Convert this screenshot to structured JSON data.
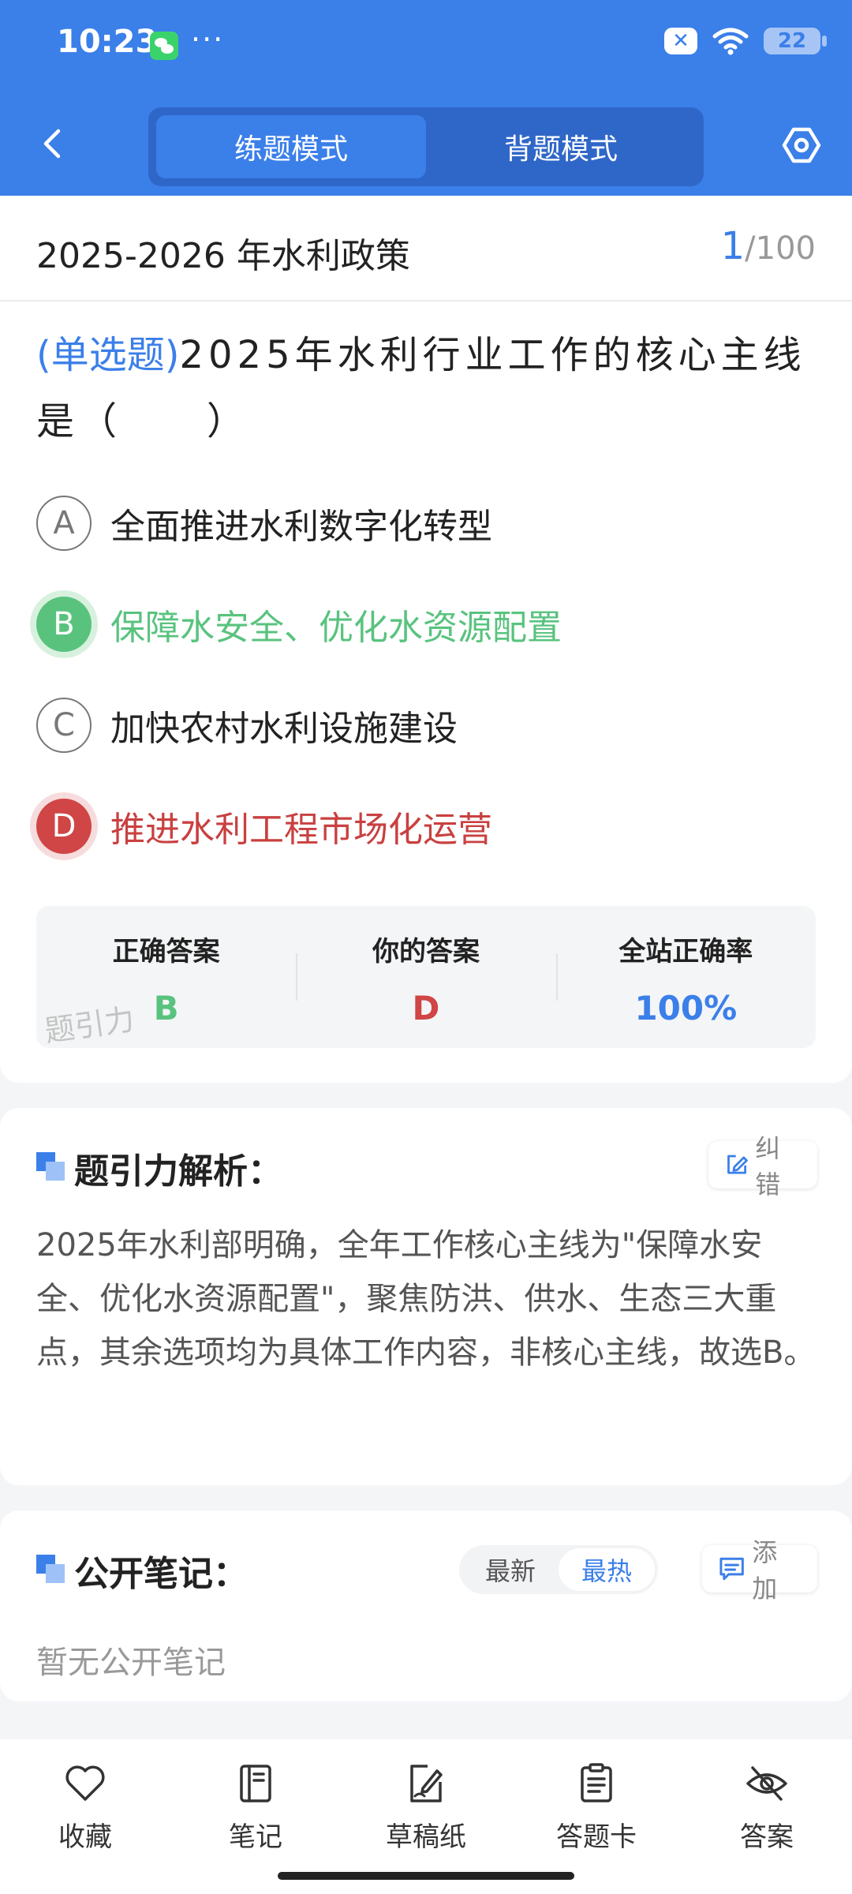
{
  "status_bar": {
    "time": "10:23",
    "more": "···",
    "notif_badge": "✕",
    "battery": "22"
  },
  "header": {
    "modes": [
      "练题模式",
      "背题模式"
    ],
    "active_mode": 0
  },
  "question_card": {
    "subject": "2025-2026 年水利政策",
    "progress_current": "1",
    "progress_total": "/100",
    "question_type": "(单选题)",
    "question_text": "2025年水利行业工作的核心主线是（　　）",
    "options": [
      {
        "letter": "A",
        "text": "全面推进水利数字化转型",
        "state": "normal"
      },
      {
        "letter": "B",
        "text": "保障水安全、优化水资源配置",
        "state": "correct"
      },
      {
        "letter": "C",
        "text": "加快农村水利设施建设",
        "state": "normal"
      },
      {
        "letter": "D",
        "text": "推进水利工程市场化运营",
        "state": "wrong"
      }
    ],
    "summary": {
      "correct_label": "正确答案",
      "correct_value": "B",
      "yours_label": "你的答案",
      "yours_value": "D",
      "rate_label": "全站正确率",
      "rate_value": "100%"
    },
    "watermark": "题引力"
  },
  "analysis": {
    "title": "题引力解析：",
    "correct_btn": "纠错",
    "text": "2025年水利部明确，全年工作核心主线为\"保障水安全、优化水资源配置\"，聚焦防洪、供水、生态三大重点，其余选项均为具体工作内容，非核心主线，故选B。"
  },
  "notes": {
    "title": "公开笔记：",
    "sort_options": [
      "最新",
      "最热"
    ],
    "active_sort": 1,
    "add_btn": "添加",
    "empty_text": "暂无公开笔记"
  },
  "bottom_tabs": [
    {
      "label": "收藏",
      "icon": "heart-icon"
    },
    {
      "label": "笔记",
      "icon": "notebook-icon"
    },
    {
      "label": "草稿纸",
      "icon": "draft-pen-icon"
    },
    {
      "label": "答题卡",
      "icon": "clipboard-icon"
    },
    {
      "label": "答案",
      "icon": "eye-off-icon"
    }
  ],
  "colors": {
    "brand_blue": "#3b7fe9",
    "correct_green": "#59c37e",
    "wrong_red": "#d04545"
  }
}
